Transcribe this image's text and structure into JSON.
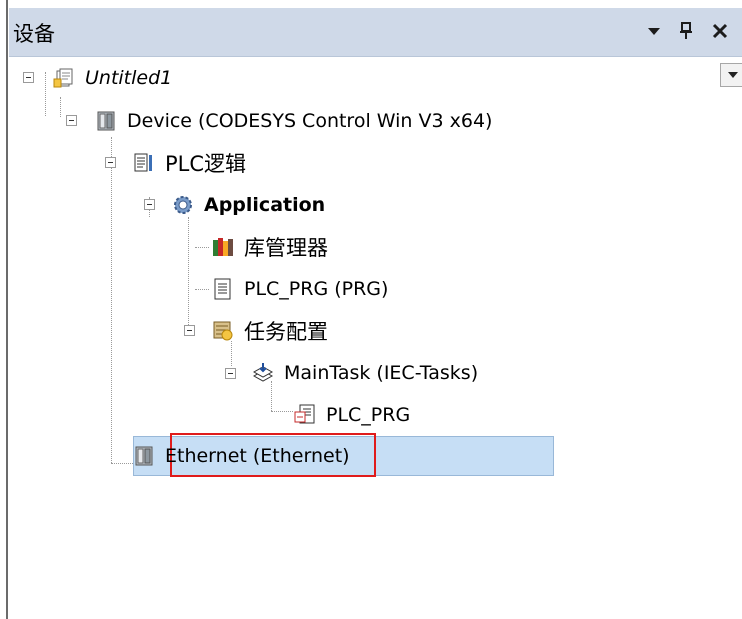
{
  "panel": {
    "title": "设备",
    "controls": {
      "dropdown": "▾",
      "pin": "ᵖ",
      "close": "✕"
    }
  },
  "tree": {
    "project": "Untitled1",
    "device": "Device (CODESYS Control Win V3 x64)",
    "plc_logic": "PLC逻辑",
    "application": "Application",
    "library_manager": "库管理器",
    "plc_prg": "PLC_PRG (PRG)",
    "task_config": "任务配置",
    "main_task": "MainTask (IEC-Tasks)",
    "task_call": "PLC_PRG",
    "ethernet": "Ethernet (Ethernet)"
  },
  "colors": {
    "selection": "#c6def5",
    "highlight": "#e01b1b",
    "titlebar": "#cfd9e8"
  }
}
